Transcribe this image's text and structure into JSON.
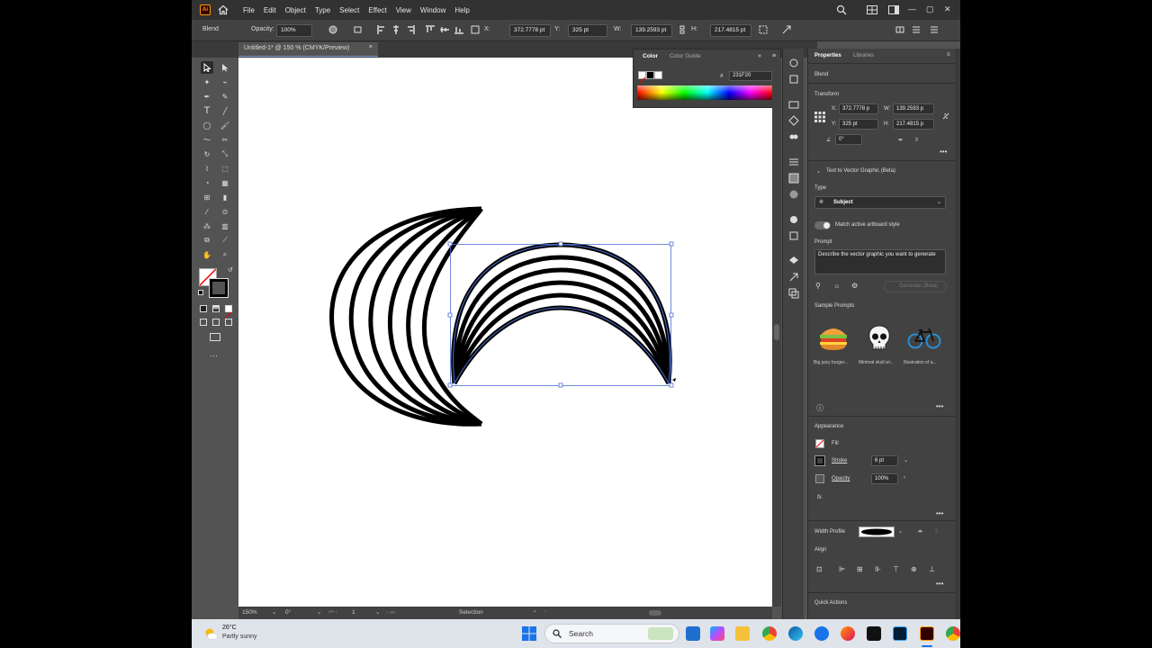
{
  "menubar": {
    "items": [
      "File",
      "Edit",
      "Object",
      "Type",
      "Select",
      "Effect",
      "View",
      "Window",
      "Help"
    ]
  },
  "controlbar": {
    "object_type": "Blend",
    "opacity_label": "Opacity:",
    "opacity_value": "100%",
    "x_label": "X:",
    "x_value": "372.7778 pt",
    "y_label": "Y:",
    "y_value": "325 pt",
    "w_label": "W:",
    "w_value": "139.2593 pt",
    "h_label": "H:",
    "h_value": "217.4815 pt"
  },
  "document_tab": {
    "title": "Untitled-1* @ 150 % (CMYK/Preview)",
    "close": "×"
  },
  "color_panel": {
    "tabs": [
      "Color",
      "Color Guide"
    ],
    "hex_label": "#",
    "hex_value": "231F20"
  },
  "properties": {
    "tabs": [
      "Properties",
      "Libraries"
    ],
    "selection_type": "Blend",
    "transform_title": "Transform",
    "x_label": "X:",
    "x_value": "372.7778 p",
    "y_label": "Y:",
    "y_value": "325 pt",
    "w_label": "W:",
    "w_value": "139.2593 p",
    "h_label": "H:",
    "h_value": "217.4815 p",
    "rotate_value": "0°",
    "t2v_title": "Text to Vector Graphic (Beta)",
    "type_label": "Type",
    "type_value": "Subject",
    "match_style": "Match active artboard style",
    "prompt_label": "Prompt",
    "prompt_placeholder": "Describe the vector graphic you want to generate",
    "generate_label": "Generate (Beta)",
    "sample_prompts_label": "Sample Prompts",
    "samples": [
      "Big juicy burger...",
      "Minimal skull wi...",
      "Illustration of a..."
    ],
    "appearance_title": "Appearance",
    "fill_label": "Fill",
    "stroke_label": "Stroke",
    "stroke_value": "6 pt",
    "opacity_label": "Opacity",
    "opacity_value": "100%",
    "fx_label": "fx.",
    "width_profile_label": "Width Profile",
    "align_title": "Align",
    "quick_actions_title": "Quick Actions"
  },
  "statusbar": {
    "zoom": "150%",
    "rotation": "0°",
    "artboard": "1",
    "tool": "Selection"
  },
  "taskbar": {
    "weather_temp": "26°C",
    "weather_desc": "Partly sunny",
    "search_label": "Search"
  },
  "colors": {
    "menubar_bg": "#323232",
    "panel_bg": "#424242",
    "workspace_bg": "#535353",
    "selection_blue": "#4d6fd1",
    "artwork_stroke": "#231F20"
  }
}
